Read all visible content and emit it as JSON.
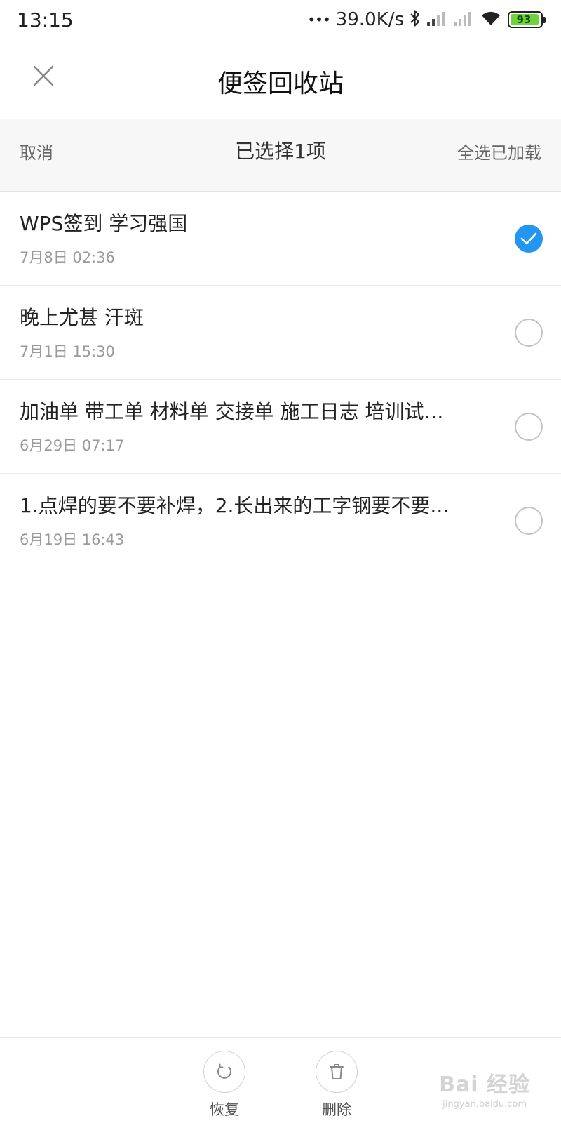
{
  "status_bar": {
    "time": "13:15",
    "dots": "•••",
    "network_speed": "39.0K/s",
    "battery_level": "93",
    "battery_color": "#6cd33a"
  },
  "header": {
    "title": "便签回收站",
    "close_icon": "close-icon"
  },
  "selection_bar": {
    "cancel_label": "取消",
    "selected_count_label": "已选择1项",
    "select_all_label": "全选已加载"
  },
  "notes": [
    {
      "title": "WPS签到 学习强国",
      "date": "7月8日 02:36",
      "checked": true
    },
    {
      "title": "晚上尤甚 汗斑",
      "date": "7月1日 15:30",
      "checked": false
    },
    {
      "title": "加油单 带工单 材料单 交接单 施工日志 培训试卷...",
      "date": "6月29日 07:17",
      "checked": false
    },
    {
      "title": "1.点焊的要不要补焊，2.长出来的工字钢要不要...",
      "date": "6月19日 16:43",
      "checked": false
    }
  ],
  "bottom_actions": {
    "restore_label": "恢复",
    "restore_icon": "restore-icon",
    "delete_label": "删除",
    "delete_icon": "trash-icon"
  },
  "watermark": {
    "main": "Bai 经验",
    "sub": "jingyan.baidu.com"
  },
  "colors": {
    "accent": "#2196f3",
    "select_bar_bg": "#f7f7f7"
  }
}
